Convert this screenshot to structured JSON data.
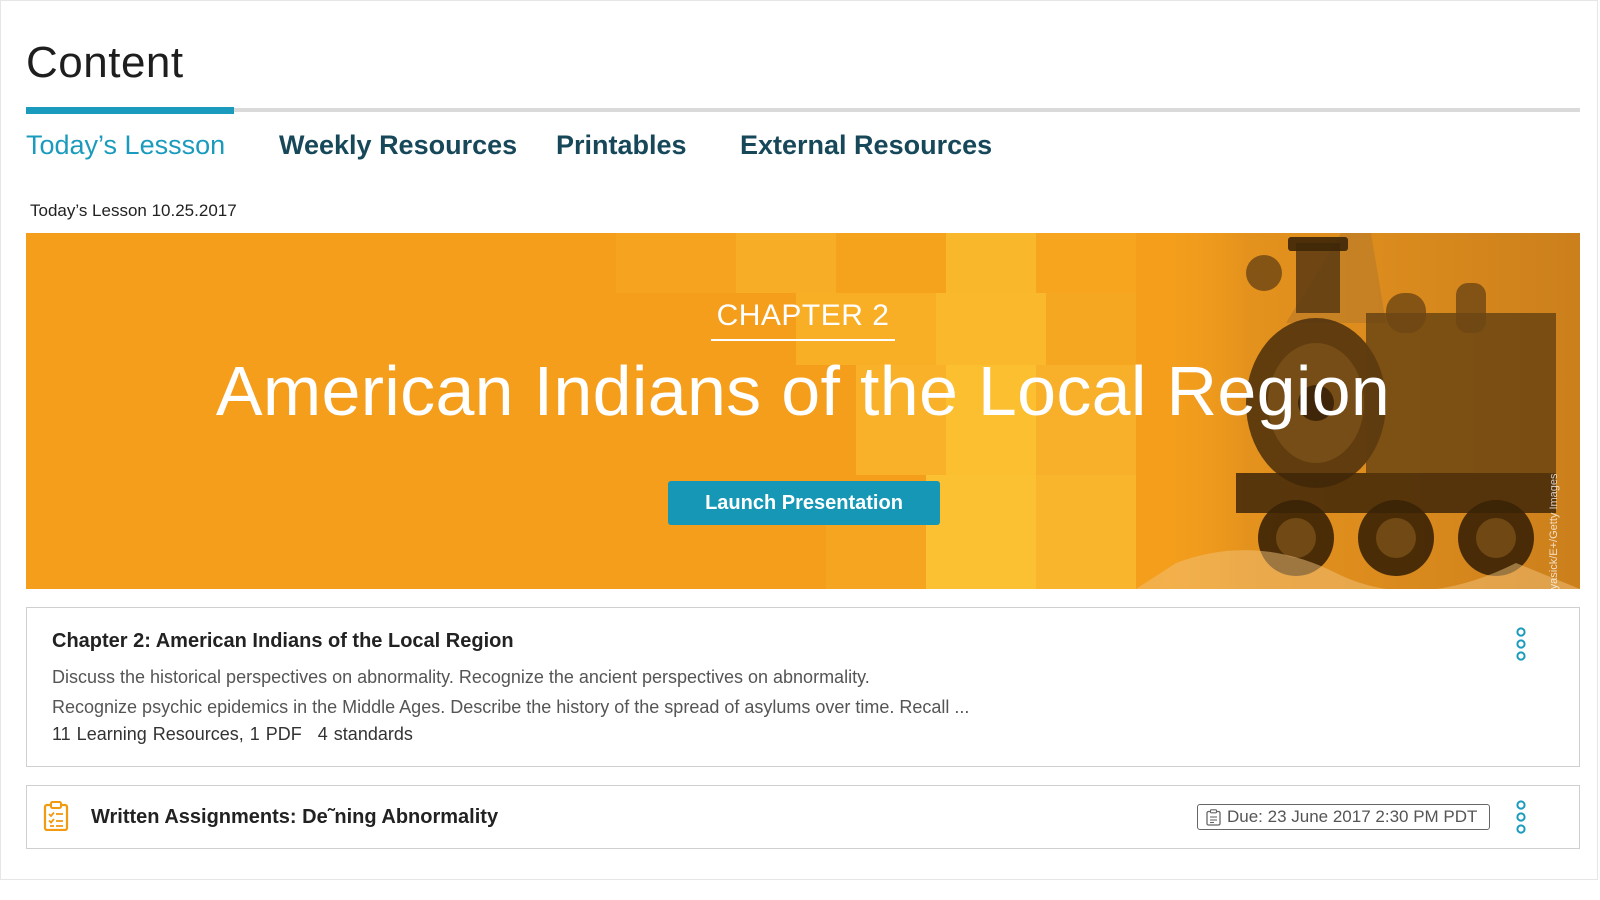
{
  "header": {
    "title": "Content"
  },
  "tabs": [
    {
      "label": "Today’s Lessson",
      "active": true
    },
    {
      "label": "Weekly Resources",
      "active": false
    },
    {
      "label": "Printables",
      "active": false
    },
    {
      "label": "External Resources",
      "active": false
    }
  ],
  "lesson": {
    "date_label": "Today’s Lesson 10.25.2017",
    "banner": {
      "chapter_label": "CHAPTER 2",
      "title": "American Indians of the Local Region",
      "launch_label": "Launch Presentation",
      "photo_credit": "ryasick/E+/Getty Images",
      "color": "#f59e1b"
    },
    "card": {
      "title": "Chapter 2: American Indians of the Local Region",
      "description_line1": "Discuss the historical perspectives on abnormality. Recognize the ancient perspectives on abnormality.",
      "description_line2": "Recognize psychic epidemics in the Middle Ages. Describe the history of the spread of asylums over time. Recall ...",
      "resources": "11 Learning Resources, 1 PDF",
      "standards": "4 standards"
    }
  },
  "assignment": {
    "title": "Written Assignments: De˜ning Abnormality",
    "due": "Due: 23 June 2017 2:30 PM PDT",
    "icon": "clipboard-checklist-icon"
  },
  "colors": {
    "accent": "#1a9bbd",
    "tab_text": "#17485a",
    "button": "#1797b6"
  }
}
